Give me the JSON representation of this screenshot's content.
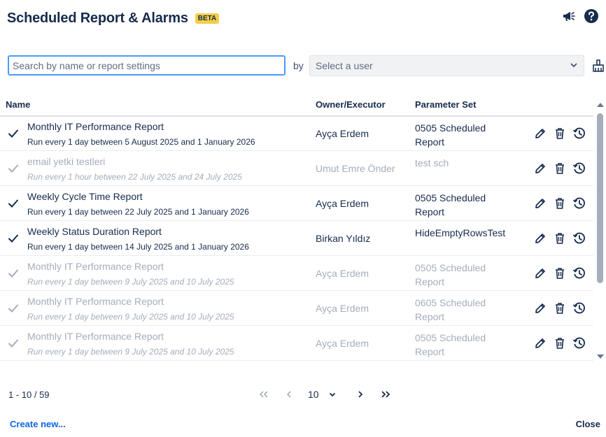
{
  "header": {
    "title": "Scheduled Report & Alarms",
    "badge": "BETA"
  },
  "icons": {
    "announce": "megaphone-icon",
    "help": "help-icon",
    "clear": "clear-filter-icon"
  },
  "filters": {
    "search_placeholder": "Search by name or report settings",
    "by_label": "by",
    "user_placeholder": "Select a user"
  },
  "table": {
    "columns": {
      "name": "Name",
      "owner": "Owner/Executor",
      "param": "Parameter Set"
    },
    "rows": [
      {
        "status": "active",
        "name": "Monthly IT Performance Report",
        "schedule": "Run every 1 day between 5 August 2025 and 1 January 2026",
        "owner": "Ayça Erdem",
        "param1": "0505 Scheduled",
        "param2": "Report"
      },
      {
        "status": "inactive",
        "name": "email yetki testleri",
        "schedule": "Run every 1 hour between 22 July 2025 and 24 July 2025",
        "owner": "Umut Emre Önder",
        "param1": "test sch",
        "param2": ""
      },
      {
        "status": "active",
        "name": "Weekly Cycle Time Report",
        "schedule": "Run every 1 day between 22 July 2025 and 1 January 2026",
        "owner": "Ayça Erdem",
        "param1": "0505 Scheduled",
        "param2": "Report"
      },
      {
        "status": "active",
        "name": "Weekly Status Duration Report",
        "schedule": "Run every 1 day between 14 July 2025 and 1 January 2026",
        "owner": "Birkan Yıldız",
        "param1": "HideEmptyRowsTest",
        "param2": ""
      },
      {
        "status": "inactive",
        "name": "Monthly IT Performance Report",
        "schedule": "Run every 1 day between 9 July 2025 and 10 July 2025",
        "owner": "Ayça Erdem",
        "param1": "0505 Scheduled",
        "param2": "Report"
      },
      {
        "status": "inactive",
        "name": "Monthly IT Performance Report",
        "schedule": "Run every 1 day between 9 July 2025 and 10 July 2025",
        "owner": "Ayça Erdem",
        "param1": "0605 Scheduled",
        "param2": "Report"
      },
      {
        "status": "inactive",
        "name": "Monthly IT Performance Report",
        "schedule": "Run every 1 day between 9 July 2025 and 10 July 2025",
        "owner": "Ayça Erdem",
        "param1": "0505 Scheduled",
        "param2": "Report"
      }
    ]
  },
  "pagination": {
    "range": "1 - 10 / 59",
    "page_size": "10"
  },
  "footer": {
    "create": "Create new...",
    "close": "Close"
  },
  "colors": {
    "active_text": "#172b4d",
    "inactive_text": "#a5adba",
    "link": "#0c66e4",
    "badge": "#f5cd47"
  }
}
